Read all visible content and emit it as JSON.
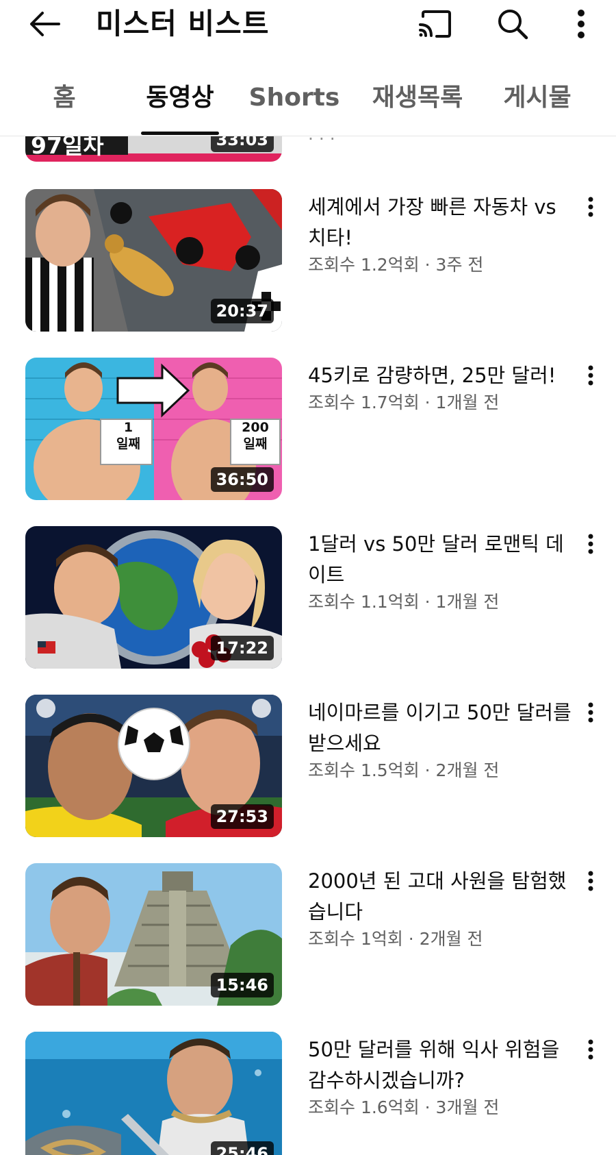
{
  "app_bar": {
    "title": "미스터 비스트",
    "icons": {
      "back": "back-arrow-icon",
      "cast": "cast-icon",
      "search": "search-icon",
      "more": "more-vert-icon"
    }
  },
  "tabs": [
    {
      "label": "홈",
      "active": false
    },
    {
      "label": "동영상",
      "active": true
    },
    {
      "label": "Shorts",
      "active": false
    },
    {
      "label": "재생목록",
      "active": false
    },
    {
      "label": "게시물",
      "active": false
    }
  ],
  "colors": {
    "text_primary": "#0f0f0f",
    "text_secondary": "#606060",
    "background": "#ffffff"
  },
  "partial_video": {
    "thumbnail_label": "97일차",
    "duration": "33:03"
  },
  "videos": [
    {
      "title": "세계에서 가장 빠른 자동차 vs 치타!",
      "views": "조회수 1.2억회",
      "age": "3주 전",
      "meta": "조회수 1.2억회 · 3주 전",
      "duration": "20:37"
    },
    {
      "title": "45키로 감량하면, 25만 달러!",
      "views": "조회수 1.7억회",
      "age": "1개월 전",
      "meta": "조회수 1.7억회 · 1개월 전",
      "duration": "36:50",
      "thumbnail_texts": [
        "1\n일째",
        "200\n일째"
      ]
    },
    {
      "title": "1달러 vs 50만 달러 로맨틱 데이트",
      "views": "조회수 1.1억회",
      "age": "1개월 전",
      "meta": "조회수 1.1억회 · 1개월 전",
      "duration": "17:22"
    },
    {
      "title": "네이마르를 이기고 50만 달러를 받으세요",
      "views": "조회수 1.5억회",
      "age": "2개월 전",
      "meta": "조회수 1.5억회 · 2개월 전",
      "duration": "27:53"
    },
    {
      "title": "2000년 된 고대 사원을 탐험했습니다",
      "views": "조회수 1억회",
      "age": "2개월 전",
      "meta": "조회수 1억회 · 2개월 전",
      "duration": "15:46"
    },
    {
      "title": "50만 달러를 위해 익사 위험을 감수하시겠습니까?",
      "views": "조회수 1.6억회",
      "age": "3개월 전",
      "meta": "조회수 1.6억회 · 3개월 전",
      "duration": "25:46"
    }
  ]
}
